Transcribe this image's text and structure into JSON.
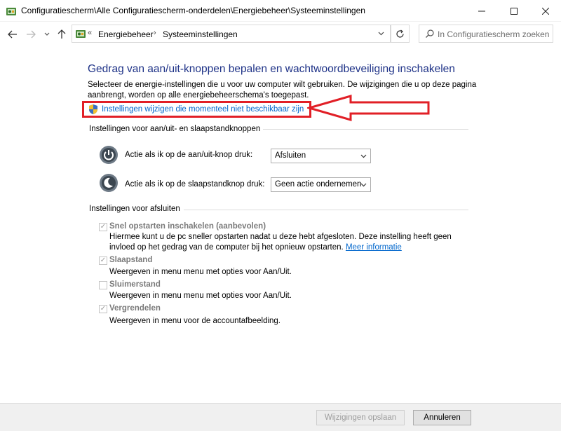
{
  "window": {
    "title": "Configuratiescherm\\Alle Configuratiescherm-onderdelen\\Energiebeheer\\Systeeminstellingen"
  },
  "address": {
    "chevron": "«",
    "crumbs": [
      "Energiebeheer",
      "Systeeminstellingen"
    ],
    "separator": "›"
  },
  "search": {
    "placeholder": "In Configuratiescherm zoeken"
  },
  "main": {
    "title": "Gedrag van aan/uit-knoppen bepalen en wachtwoordbeveiliging inschakelen",
    "intro": "Selecteer de energie-instellingen die u voor uw computer wilt gebruiken. De wijzigingen die u op deze pagina aanbrengt, worden op alle energiebeheerschema's toegepast.",
    "admin_link": "Instellingen wijzigen die momenteel niet beschikbaar zijn",
    "annotation_color": "#e11f26"
  },
  "power_section": {
    "heading": "Instellingen voor aan/uit- en slaapstandknoppen",
    "rows": [
      {
        "label": "Actie als ik op de aan/uit-knop druk:",
        "value": "Afsluiten"
      },
      {
        "label": "Actie als ik op de slaapstandknop druk:",
        "value": "Geen actie ondernemen"
      }
    ]
  },
  "shutdown_section": {
    "heading": "Instellingen voor afsluiten",
    "options": [
      {
        "label": "Snel opstarten inschakelen (aanbevolen)",
        "checked": true,
        "desc": "Hiermee kunt u de pc sneller opstarten nadat u deze hebt afgesloten. Deze instelling heeft geen invloed op het gedrag van de computer bij het opnieuw opstarten.",
        "link": "Meer informatie"
      },
      {
        "label": "Slaapstand",
        "checked": true,
        "desc": "Weergeven in menu menu met opties voor Aan/Uit."
      },
      {
        "label": "Sluimerstand",
        "checked": false,
        "desc": "Weergeven in menu menu met opties voor Aan/Uit."
      },
      {
        "label": "Vergrendelen",
        "checked": true,
        "desc": "Weergeven in menu voor de accountafbeelding."
      }
    ]
  },
  "footer": {
    "save": "Wijzigingen opslaan",
    "cancel": "Annuleren"
  },
  "icons": {
    "window": "control-panel-icon",
    "shield": "uac-shield-icon",
    "power": "power-button-icon",
    "sleep": "sleep-button-icon"
  }
}
